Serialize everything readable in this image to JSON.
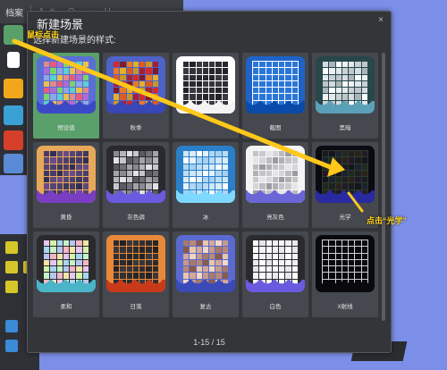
{
  "app": {
    "menu_label": "档案",
    "menu_fragment": "A# O ‹ H"
  },
  "dialog": {
    "title": "新建场景",
    "subtitle": "选择新建场景的样式:",
    "close_label": "×",
    "pager": "1-15 / 15"
  },
  "scenes": [
    {
      "label": "预设值",
      "bg": "#5a6fd6",
      "wave": "#3c49c7",
      "cells": [
        "#e08a8a",
        "#7bd46a",
        "#e8c24a",
        "#b06ad6",
        "#5ad0d0",
        "#e85a7a",
        "#8fa6e8"
      ],
      "selected": true
    },
    {
      "label": "秋季",
      "bg": "#4d63c8",
      "wave": "#3747b8",
      "cells": [
        "#d6282a",
        "#e0b12a",
        "#a12238",
        "#e87a26",
        "#c8972a",
        "#7e1a2a",
        "#e05a20"
      ]
    },
    {
      "label": "",
      "bg": "#ffffff",
      "wave": "#f4f4f4",
      "cells": [
        "#2a2a30",
        "#333338",
        "#26262c",
        "#3a3a40",
        "#2e2e34",
        "#222228",
        "#36363c"
      ]
    },
    {
      "label": "截图",
      "bg": "#1f63c8",
      "wave": "#0a4aa8",
      "cells": [
        "#2a76d8",
        "#2a76d8",
        "#2a76d8",
        "#2a76d8",
        "#2a76d8",
        "#2a76d8",
        "#2a76d8"
      ],
      "lines": true
    },
    {
      "label": "黑暗",
      "bg": "#27474a",
      "wave": "#5aa0b8",
      "cells": [
        "#d6dcdf",
        "#eef1f3",
        "#bfc7cb",
        "#ffffff",
        "#c9d1d5",
        "#aab5ba",
        "#e3e8ea"
      ]
    },
    {
      "label": "黄昏",
      "bg": "#e8a85a",
      "wave": "#7a3ec4",
      "cells": [
        "#4a3a6a",
        "#6a4a8a",
        "#3a3a5a",
        "#5a4a7a",
        "#4a4070",
        "#2f2f55",
        "#554577"
      ]
    },
    {
      "label": "灰色调",
      "bg": "#2a2a2e",
      "wave": "#6a5ae0",
      "cells": [
        "#8a8a90",
        "#c6c6cc",
        "#a2a2a8",
        "#e2e2e6",
        "#707076",
        "#b4b4ba",
        "#5a5a60"
      ]
    },
    {
      "label": "冰",
      "bg": "#2a7fc8",
      "wave": "#7fd8ff",
      "cells": [
        "#cfe6f8",
        "#e6f2fc",
        "#bcdcf4",
        "#ffffff",
        "#a6d0f0",
        "#d8ecfa",
        "#b0d6f2"
      ]
    },
    {
      "label": "亮灰色",
      "bg": "#f4f4f4",
      "wave": "#6a66d8",
      "cells": [
        "#c4c4c8",
        "#d6d6da",
        "#b0b0b4",
        "#e6e6ea",
        "#9c9ca0",
        "#cacace",
        "#bcbcc0"
      ]
    },
    {
      "label": "光学",
      "bg": "#0a0a12",
      "wave": "#2a2aa0",
      "cells": [
        "#1a1a22",
        "#1e2a1e",
        "#22182a",
        "#1a2230",
        "#2a221a",
        "#14141c",
        "#202020"
      ],
      "lines": true
    },
    {
      "label": "柔和",
      "bg": "#2a2a2e",
      "wave": "#4ab4c8",
      "cells": [
        "#e8c6f2",
        "#c6f2c6",
        "#f2e6a6",
        "#a6d6f2",
        "#f2b6c6",
        "#d6f2a6",
        "#b6c6f2"
      ]
    },
    {
      "label": "日落",
      "bg": "#e8893a",
      "wave": "#c83a1a",
      "cells": [
        "#2a2a2e",
        "#333338",
        "#26262a",
        "#38383c",
        "#2c2c30",
        "#222226",
        "#303034"
      ]
    },
    {
      "label": "复古",
      "bg": "#5a6ad0",
      "wave": "#3a4ab8",
      "cells": [
        "#a87a6a",
        "#e8c8a8",
        "#c89a8a",
        "#8a5a4a",
        "#f2d6c6",
        "#b88878",
        "#d6a898"
      ]
    },
    {
      "label": "白色",
      "bg": "#2a2a2e",
      "wave": "#6a5ae0",
      "cells": [
        "#ffffff",
        "#f4f4f6",
        "#eaeaee",
        "#ffffff",
        "#f0f0f2",
        "#e6e6ea",
        "#fafafa"
      ]
    },
    {
      "label": "X射线",
      "bg": "#0a0a0e",
      "wave": "#0a0a0e",
      "cells": [
        "#0a0a0e",
        "#0a0a0e",
        "#0a0a0e",
        "#0a0a0e",
        "#0a0a0e",
        "#0a0a0e",
        "#0a0a0e"
      ],
      "lines": true
    }
  ],
  "annotations": {
    "click_mouse": "鼠标点击",
    "click_optics": "点击“光学”",
    "arrow_color": "#ffc81a"
  },
  "icons": [
    "new-scene-icon",
    "layers-icon",
    "folder-icon",
    "landscape-icon",
    "photo-icon",
    "image-icon",
    "hand-icon",
    "move-icon",
    "rotate-icon",
    "select-icon",
    "pencil-icon"
  ]
}
